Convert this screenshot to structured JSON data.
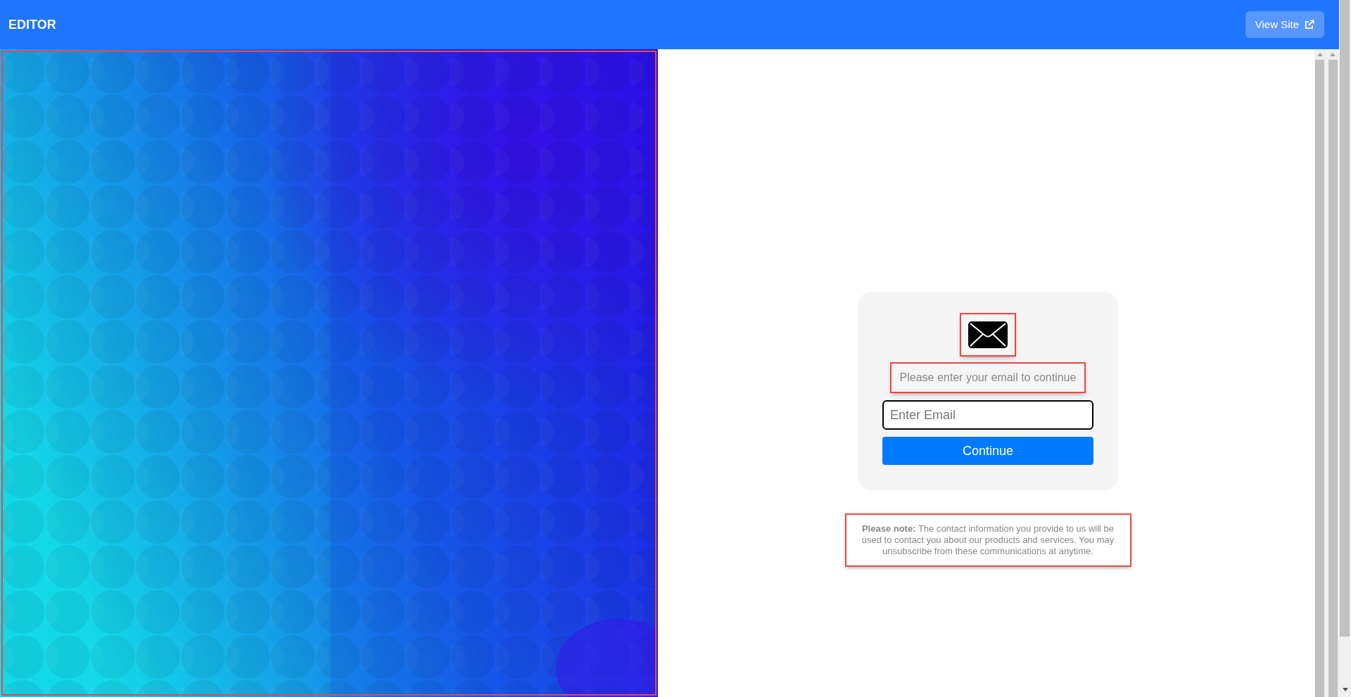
{
  "header": {
    "title": "EDITOR",
    "view_site_button": "View Site"
  },
  "background": {
    "kind": "picture",
    "selected": true
  },
  "card": {
    "icon": {
      "selected": true
    },
    "prompt": {
      "text": "Please enter your email to continue",
      "selected": true
    },
    "email_field": {
      "placeholder": "Enter Email",
      "selected": false
    },
    "continue_button": {
      "label": "Continue",
      "selected": false
    }
  },
  "note": {
    "text": "**Please note:** The contact information you provide to us will be used to contact you about our products and services. You may unsubscribe from these communications at anytime.",
    "selected": true
  }
}
